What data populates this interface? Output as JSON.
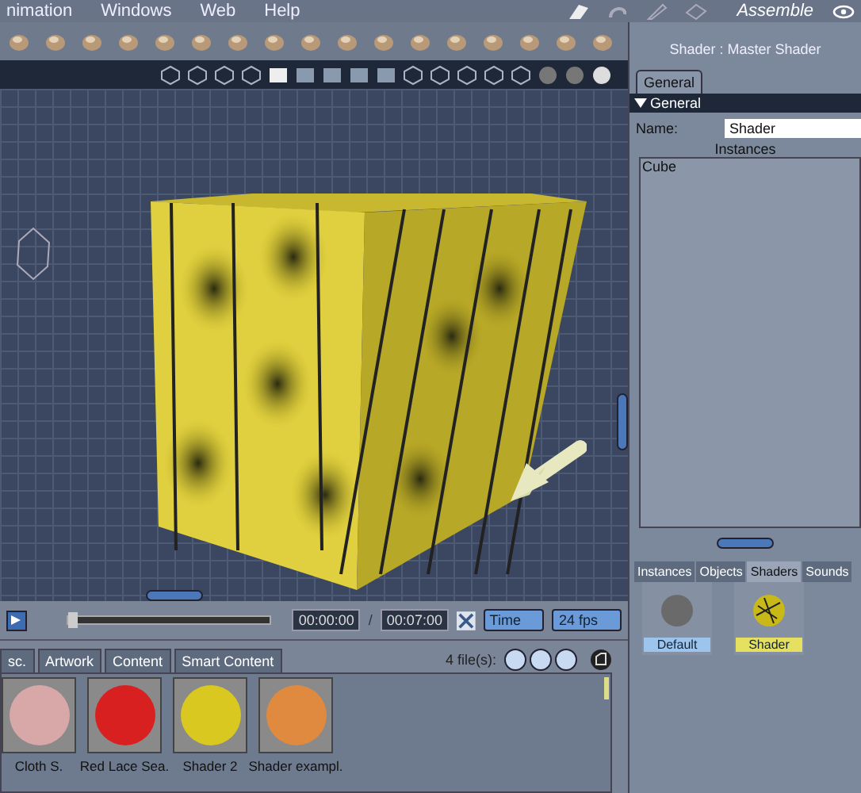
{
  "menu": [
    "nimation",
    "Windows",
    "Web",
    "Help"
  ],
  "room": {
    "label": "Assemble"
  },
  "timeline": {
    "level": 0,
    "start": "00:00:00",
    "separator": "/",
    "end": "00:07:00",
    "mode": "Time",
    "fps": "24 fps"
  },
  "browser": {
    "tabs": [
      "sc.",
      "Artwork",
      "Content",
      "Smart Content"
    ],
    "count": "4 file(s):",
    "items": [
      {
        "label": "Cloth S.",
        "color": "#d8a8a8"
      },
      {
        "label": "Red Lace Sea.",
        "color": "#d82020"
      },
      {
        "label": "Shader 2",
        "color": "#d8c820"
      },
      {
        "label": "Shader exampl.",
        "color": "#e08a40"
      }
    ]
  },
  "properties": {
    "title": "Shader : Master Shader",
    "tab": "General",
    "section": {
      "label": "General",
      "expanded": true
    },
    "name_label": "Name:",
    "name_value": "Shader",
    "instances_label": "Instances",
    "instances": [
      "Cube"
    ]
  },
  "sequencer": {
    "tabs": [
      {
        "label": "Instances",
        "selected": false
      },
      {
        "label": "Objects",
        "selected": false
      },
      {
        "label": "Shaders",
        "selected": true
      },
      {
        "label": "Sounds",
        "selected": false
      }
    ],
    "items": [
      {
        "label": "Default",
        "selected": false
      },
      {
        "label": "Shader",
        "selected": true
      }
    ]
  }
}
